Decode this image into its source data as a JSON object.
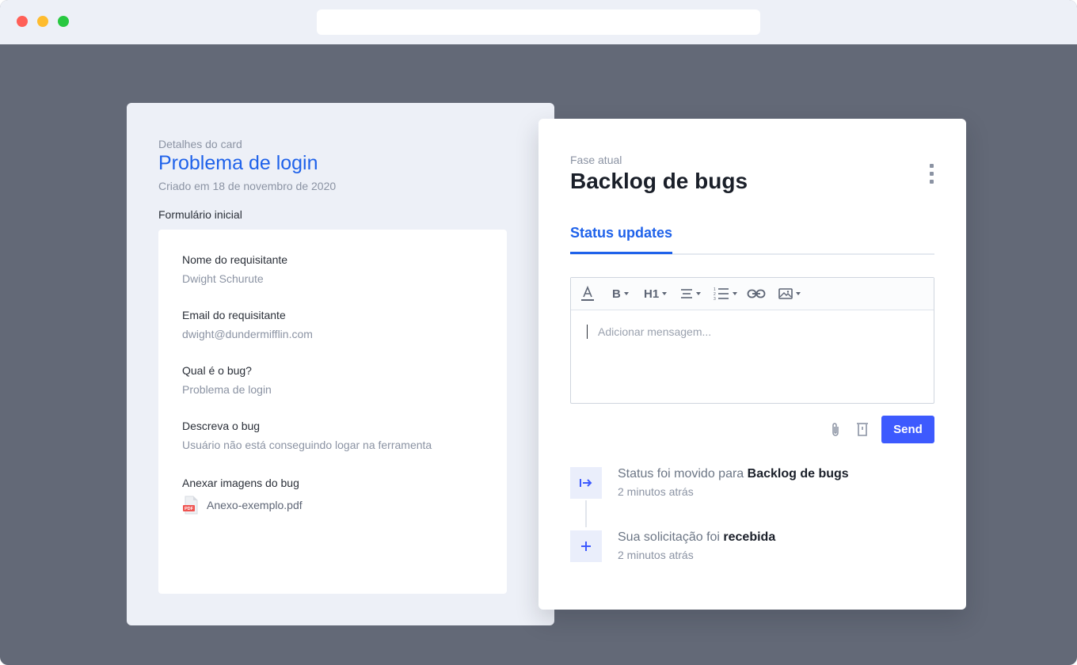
{
  "colors": {
    "accent": "#1f62ea",
    "send_button": "#3d5afe",
    "backdrop": "#636977",
    "panel_bg": "#edf0f7"
  },
  "card_details": {
    "eyebrow": "Detalhes do card",
    "title": "Problema de login",
    "created": "Criado em 18 de novembro de 2020",
    "form_section_label": "Formulário inicial",
    "fields": [
      {
        "label": "Nome do requisitante",
        "value": "Dwight Schurute"
      },
      {
        "label": "Email do requisitante",
        "value": "dwight@dundermifflin.com"
      },
      {
        "label": "Qual é o bug?",
        "value": "Problema de login"
      },
      {
        "label": "Descreva o bug",
        "value": "Usuário não está conseguindo logar na ferramenta"
      }
    ],
    "attachment": {
      "label": "Anexar imagens do bug",
      "file_name": "Anexo-exemplo.pdf",
      "file_icon_text": "PDF",
      "file_icon": "pdf-file-icon"
    }
  },
  "phase_panel": {
    "phase_label": "Fase atual",
    "phase_title": "Backlog de bugs",
    "menu_icon": "kebab-menu-icon",
    "tabs": [
      {
        "label": "Status updates",
        "active": true
      }
    ],
    "editor": {
      "toolbar": [
        {
          "icon": "text-color-icon"
        },
        {
          "icon": "bold-icon",
          "label": "B",
          "dropdown": true
        },
        {
          "icon": "heading-icon",
          "label": "H1",
          "dropdown": true
        },
        {
          "icon": "align-icon",
          "dropdown": true
        },
        {
          "icon": "ordered-list-icon",
          "dropdown": true
        },
        {
          "icon": "link-icon"
        },
        {
          "icon": "image-icon",
          "dropdown": true
        }
      ],
      "placeholder": "Adicionar mensagem..."
    },
    "actions": {
      "attach_icon": "paperclip-icon",
      "delete_icon": "trash-icon",
      "send_label": "Send"
    },
    "timeline": [
      {
        "icon": "move-arrow-icon",
        "text_prefix": "Status foi movido para ",
        "text_emphasis": "Backlog de bugs",
        "time": "2 minutos atrás"
      },
      {
        "icon": "plus-icon",
        "text_prefix": "Sua solicitação foi ",
        "text_emphasis": "recebida",
        "time": "2 minutos atrás"
      }
    ]
  }
}
